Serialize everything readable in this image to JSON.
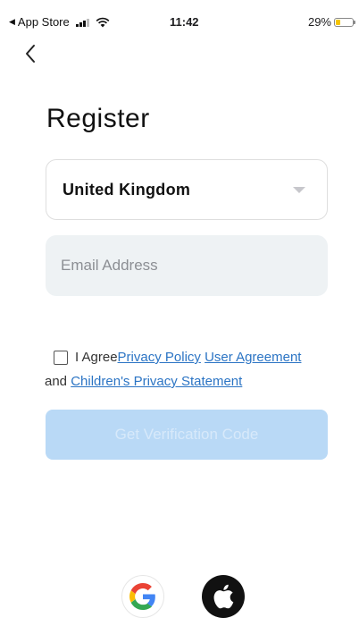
{
  "status_bar": {
    "back_app": "App Store",
    "time": "11:42",
    "battery": "29%",
    "battery_level": 0.29
  },
  "nav": {
    "back_icon": "chevron-left-icon"
  },
  "page": {
    "title": "Register"
  },
  "form": {
    "country": {
      "selected": "United Kingdom",
      "icon": "caret-down-icon"
    },
    "email": {
      "value": "",
      "placeholder": "Email Address"
    },
    "agreement": {
      "checked": false,
      "prefix": "I Agree",
      "privacy_policy": "Privacy Policy",
      "user_agreement": "User Agreement",
      "conjunction": "and",
      "children_privacy": "Children's Privacy Statement"
    },
    "submit_label": "Get Verification Code"
  },
  "social_login": [
    {
      "provider": "google",
      "icon": "google-icon"
    },
    {
      "provider": "apple",
      "icon": "apple-icon"
    }
  ],
  "colors": {
    "accent_link": "#2b74c4",
    "button_disabled_bg": "#b9d9f6",
    "input_bg": "#eef2f4",
    "battery_fill": "#f5c400"
  }
}
